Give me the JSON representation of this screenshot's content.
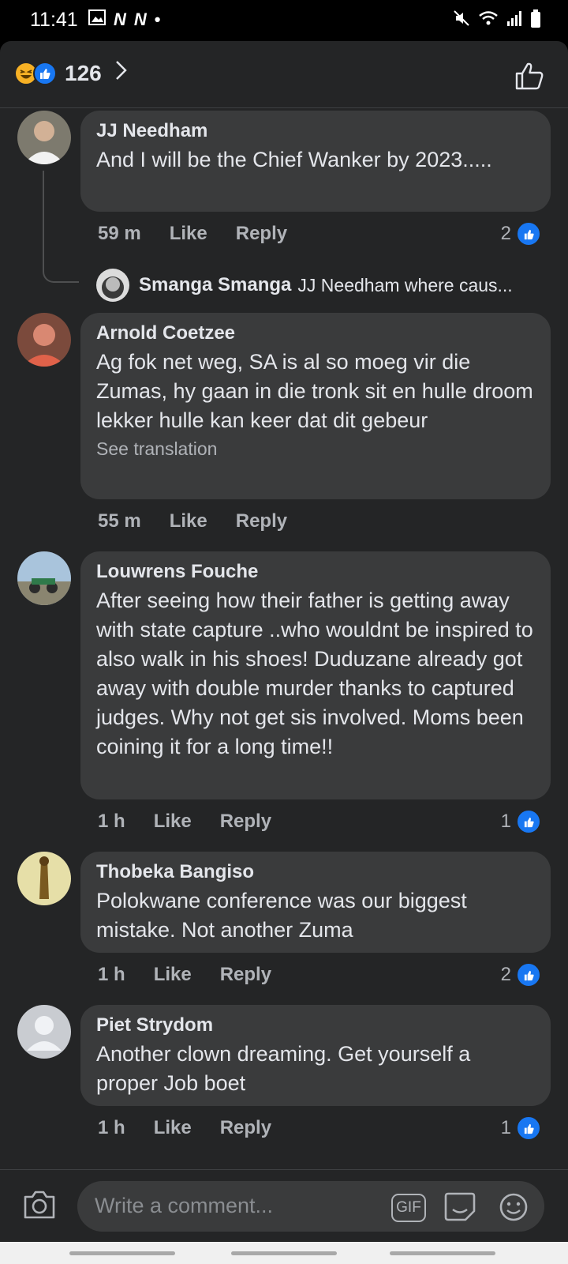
{
  "status_bar": {
    "time": "11:41",
    "left_icons": [
      "image-icon",
      "n-icon",
      "n-icon",
      "dot-icon"
    ],
    "right_icons": [
      "mute-icon",
      "wifi-icon",
      "signal-icon",
      "battery-icon"
    ]
  },
  "header": {
    "reaction_icons": [
      "haha-icon",
      "like-icon"
    ],
    "reaction_count": "126"
  },
  "comments": [
    {
      "author": "JJ Needham",
      "text": "And I will be the Chief Wanker by 2023.....",
      "time": "59 m",
      "like": "Like",
      "reply": "Reply",
      "reactions": "2",
      "reply_preview": {
        "author": "Smanga Smanga",
        "text": "JJ Needham where caus..."
      }
    },
    {
      "author": "Arnold Coetzee",
      "text": "Ag fok net weg, SA is al so moeg vir die Zumas, hy gaan in die tronk sit en hulle droom lekker hulle kan keer dat dit gebeur",
      "see_translation": "See translation",
      "time": "55 m",
      "like": "Like",
      "reply": "Reply"
    },
    {
      "author": "Louwrens Fouche",
      "text": "After seeing how their father is getting away with state capture ..who wouldnt be inspired to also walk in his shoes! Duduzane already got away with double murder thanks to captured judges. Why not get sis involved. Moms been coining it for a long time!!",
      "time": "1 h",
      "like": "Like",
      "reply": "Reply",
      "reactions": "1"
    },
    {
      "author": "Thobeka Bangiso",
      "text": "Polokwane conference was our biggest mistake.  Not another Zuma",
      "time": "1 h",
      "like": "Like",
      "reply": "Reply",
      "reactions": "2"
    },
    {
      "author": "Piet Strydom",
      "text": "Another clown dreaming. Get yourself a proper Job boet",
      "time": "1 h",
      "like": "Like",
      "reply": "Reply",
      "reactions": "1"
    }
  ],
  "composer": {
    "placeholder": "Write a comment...",
    "gif_label": "GIF"
  },
  "colors": {
    "background": "#242526",
    "bubble": "#3a3b3c",
    "text": "#e4e6eb",
    "secondary_text": "#b0b3b8",
    "like_blue": "#1877f2"
  }
}
